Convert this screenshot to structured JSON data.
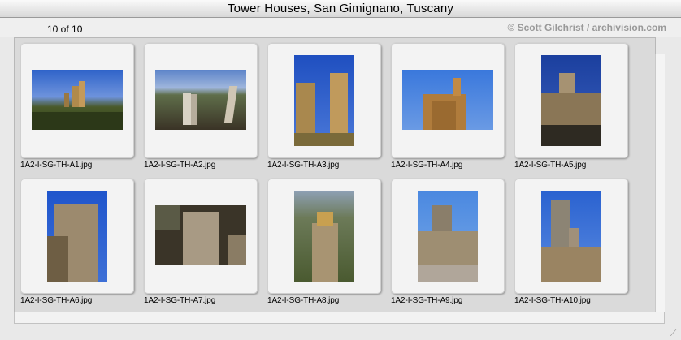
{
  "window": {
    "title": "Tower Houses, San Gimignano, Tuscany"
  },
  "header": {
    "count": "10 of 10",
    "copyright": "© Scott Gilchrist / archivision.com"
  },
  "thumbnails": [
    {
      "filename": "1A2-I-SG-TH-A1.jpg",
      "orientation": "landscape"
    },
    {
      "filename": "1A2-I-SG-TH-A2.jpg",
      "orientation": "landscape"
    },
    {
      "filename": "1A2-I-SG-TH-A3.jpg",
      "orientation": "portrait"
    },
    {
      "filename": "1A2-I-SG-TH-A4.jpg",
      "orientation": "landscape"
    },
    {
      "filename": "1A2-I-SG-TH-A5.jpg",
      "orientation": "portrait"
    },
    {
      "filename": "1A2-I-SG-TH-A6.jpg",
      "orientation": "portrait"
    },
    {
      "filename": "1A2-I-SG-TH-A7.jpg",
      "orientation": "landscape"
    },
    {
      "filename": "1A2-I-SG-TH-A8.jpg",
      "orientation": "portrait"
    },
    {
      "filename": "1A2-I-SG-TH-A9.jpg",
      "orientation": "portrait"
    },
    {
      "filename": "1A2-I-SG-TH-A10.jpg",
      "orientation": "portrait"
    }
  ],
  "colors": {
    "sky": "#3b6fd1",
    "stone": "#b8925a",
    "shadow": "#3a3a2a"
  }
}
